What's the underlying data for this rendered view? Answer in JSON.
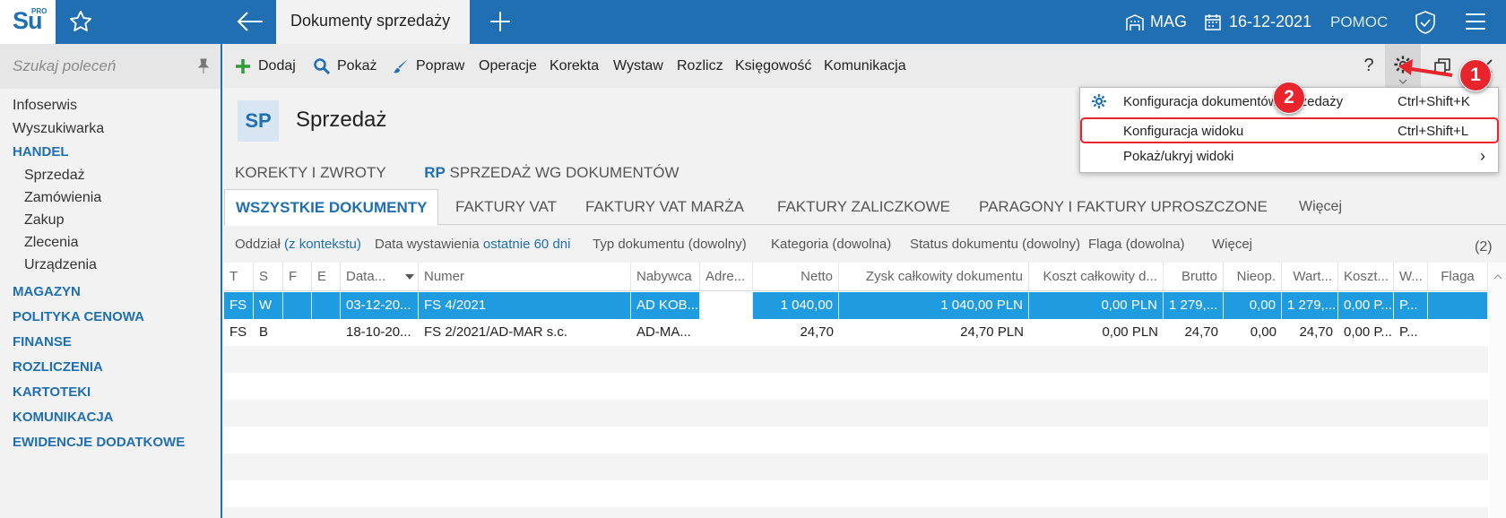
{
  "app": {
    "logo_text": "Su",
    "logo_sup": "PRO",
    "active_tab": "Dokumenty sprzedaży",
    "warehouse": "MAG",
    "date": "16-12-2021",
    "help": "POMOC"
  },
  "sidebar": {
    "search_placeholder": "Szukaj poleceń",
    "items": [
      {
        "label": "Infoserwis",
        "kind": "item"
      },
      {
        "label": "Wyszukiwarka",
        "kind": "item"
      },
      {
        "label": "HANDEL",
        "kind": "section"
      },
      {
        "label": "Sprzedaż",
        "kind": "sub"
      },
      {
        "label": "Zamówienia",
        "kind": "sub"
      },
      {
        "label": "Zakup",
        "kind": "sub"
      },
      {
        "label": "Zlecenia",
        "kind": "sub"
      },
      {
        "label": "Urządzenia",
        "kind": "sub"
      },
      {
        "label": "MAGAZYN",
        "kind": "section"
      },
      {
        "label": "POLITYKA CENOWA",
        "kind": "section"
      },
      {
        "label": "FINANSE",
        "kind": "section"
      },
      {
        "label": "ROZLICZENIA",
        "kind": "section"
      },
      {
        "label": "KARTOTEKI",
        "kind": "section"
      },
      {
        "label": "KOMUNIKACJA",
        "kind": "section"
      },
      {
        "label": "EWIDENCJE DODATKOWE",
        "kind": "section"
      }
    ]
  },
  "toolbar": {
    "add": "Dodaj",
    "show": "Pokaż",
    "edit": "Popraw",
    "operations": "Operacje",
    "correction": "Korekta",
    "issue": "Wystaw",
    "settle": "Rozlicz",
    "accounting": "Księgowość",
    "communication": "Komunikacja",
    "help": "?"
  },
  "header": {
    "code": "SP",
    "title": "Sprzedaż"
  },
  "tabs_row1": {
    "corrections": "KOREKTY I ZWROTY",
    "rp_code": "RP",
    "rp_label": "SPRZEDAŻ WG DOKUMENTÓW"
  },
  "tabs_row2": {
    "all": "WSZYSTKIE DOKUMENTY",
    "vat": "FAKTURY VAT",
    "vat_margin": "FAKTURY VAT MARŻA",
    "advance": "FAKTURY ZALICZKOWE",
    "receipts": "PARAGONY I FAKTURY UPROSZCZONE",
    "more": "Więcej"
  },
  "filters": {
    "branch_label": "Oddział",
    "branch_value": "(z kontekstu)",
    "date_label": "Data wystawienia",
    "date_value": "ostatnie 60 dni",
    "doc_type": "Typ dokumentu (dowolny)",
    "category": "Kategoria (dowolna)",
    "status": "Status dokumentu (dowolny)",
    "flag": "Flaga (dowolna)",
    "more": "Więcej",
    "count": "(2)"
  },
  "grid": {
    "columns": [
      "T",
      "S",
      "F",
      "E",
      "Data...",
      "Numer",
      "Nabywca",
      "Adre...",
      "Netto",
      "Zysk całkowity dokumentu",
      "Koszt całkowity d...",
      "Brutto",
      "Nieop.",
      "Wart...",
      "Koszt...",
      "W...",
      "Flaga"
    ],
    "rows": [
      [
        "FS",
        "W",
        "",
        "",
        "03-12-20...",
        "FS 4/2021",
        "AD KOB...",
        "",
        "1 040,00",
        "1 040,00 PLN",
        "0,00 PLN",
        "1 279,...",
        "0,00",
        "1 279,...",
        "0,00 P...",
        "P...",
        ""
      ],
      [
        "FS",
        "B",
        "",
        "",
        "18-10-20...",
        "FS 2/2021/AD-MAR s.c.",
        "AD-MA...",
        "",
        "24,70",
        "24,70 PLN",
        "0,00 PLN",
        "24,70",
        "0,00",
        "24,70",
        "0,00 P...",
        "P...",
        ""
      ]
    ]
  },
  "dropdown": {
    "items": [
      {
        "label": "Konfiguracja dokumentów sprzedaży",
        "shortcut": "Ctrl+Shift+K"
      },
      {
        "label": "Konfiguracja widoku",
        "shortcut": "Ctrl+Shift+L"
      },
      {
        "label": "Pokaż/ukryj widoki",
        "shortcut": "›"
      }
    ]
  },
  "annotations": {
    "step1": "1",
    "step2": "2"
  },
  "colors": {
    "brand": "#1f6fb2",
    "selection": "#1f9be0",
    "annotation": "#e8242c"
  }
}
